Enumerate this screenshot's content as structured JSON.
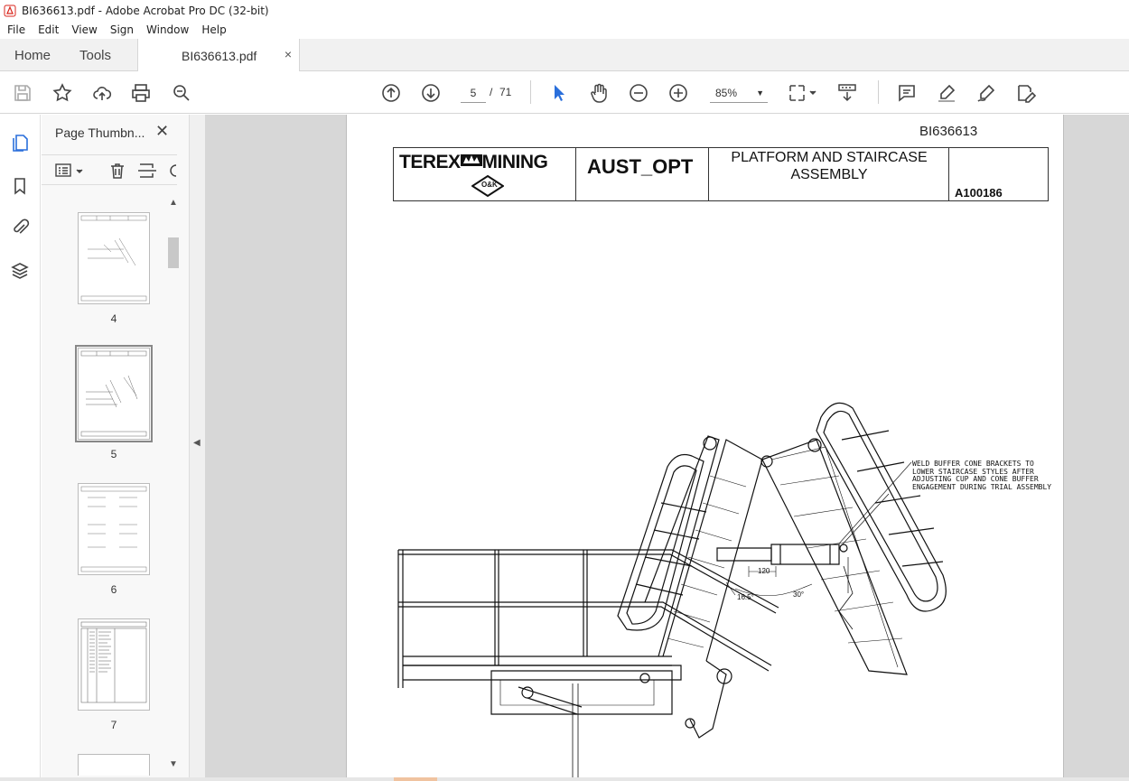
{
  "window": {
    "title": "BI636613.pdf - Adobe Acrobat Pro DC (32-bit)"
  },
  "menu": [
    "File",
    "Edit",
    "View",
    "Sign",
    "Window",
    "Help"
  ],
  "tabs": {
    "home": "Home",
    "tools": "Tools",
    "document": "BI636613.pdf",
    "close": "×"
  },
  "toolbar": {
    "current_page": "5",
    "separator": "/",
    "total_pages": "71",
    "zoom": "85%"
  },
  "sidebar": {
    "panel_title": "Page Thumbn...",
    "thumbnails": [
      {
        "label": "4"
      },
      {
        "label": "5"
      },
      {
        "label": "6"
      },
      {
        "label": "7"
      }
    ]
  },
  "document": {
    "doc_id": "BI636613",
    "brand_left": "TEREX",
    "brand_right": "MINING",
    "brand_mark": "O&K",
    "model": "AUST_OPT",
    "title_line1": "PLATFORM AND STAIRCASE",
    "title_line2": "ASSEMBLY",
    "drawing_number": "A100186",
    "note_lines": [
      "WELD BUFFER CONE BRACKETS TO",
      "LOWER STAIRCASE STYLES AFTER",
      "ADJUSTING CUP AND CONE BUFFER",
      "ENGAGEMENT DURING TRIAL ASSEMBLY"
    ],
    "dims": {
      "d1": "120",
      "d2": "16.5°",
      "d3": "30°"
    }
  },
  "colors": {
    "accent": "#2a6fdb",
    "pdf_red": "#d9261c"
  }
}
